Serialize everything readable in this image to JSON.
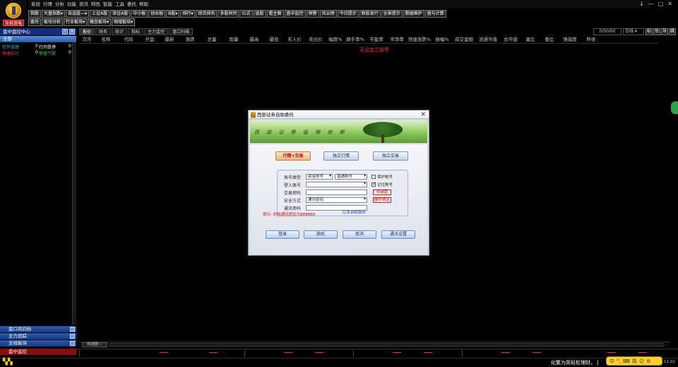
{
  "app": {
    "logo_label": "东财双电"
  },
  "menu": [
    "系统",
    "行情",
    "分析",
    "功能",
    "资讯",
    "特色",
    "智能",
    "工具",
    "委托",
    "帮助"
  ],
  "window_controls": [
    "↓",
    "—",
    "□",
    "✕"
  ],
  "toolbar1": [
    "指数",
    "大盘指数▾",
    "自选股—▾",
    "上证A股",
    "深证A股",
    "中小板",
    "创业板",
    "B股▾",
    "排行▾",
    "综合排名",
    "多股同列",
    "公式",
    "选股",
    "看主图",
    "盘中监控",
    "预警",
    "风云榜",
    "今日提示",
    "新股发行",
    "全景提示",
    "数据维护",
    "盘与计算"
  ],
  "toolbar2": [
    "委托",
    "板块分析",
    "行业板块▾",
    "概念板块▾",
    "地域板块▾"
  ],
  "left_panel": {
    "title": "盘中盘控中心",
    "section": "全部",
    "rows": [
      {
        "label": "打开涨停",
        "value": "0",
        "label2": "打开跌停",
        "value2": "0"
      },
      {
        "label": "快速拉升",
        "value": "0",
        "label2": "快速下跌",
        "value2": "0"
      }
    ],
    "footers": [
      "盘口风向标",
      "主力追踪",
      "主线板块"
    ],
    "bottom_label": "盘中监控"
  },
  "main_tabs": [
    "报价",
    "财务",
    "统计",
    "指标",
    "主力监控",
    "盘口扫描"
  ],
  "date_box": "0/00/00",
  "date_select": "日线 ▾",
  "right_buttons": [
    "标",
    "估",
    "导",
    "跳"
  ],
  "table": {
    "columns": [
      {
        "label": "次序",
        "w": 22
      },
      {
        "label": "名称",
        "w": 32
      },
      {
        "label": "代码",
        "w": 32
      },
      {
        "label": "开盘",
        "w": 28
      },
      {
        "label": "最新",
        "w": 28
      },
      {
        "label": "涨跌",
        "w": 30
      },
      {
        "label": "总量",
        "w": 32
      },
      {
        "label": "现量",
        "w": 30
      },
      {
        "label": "最高",
        "w": 28
      },
      {
        "label": "最低",
        "w": 28
      },
      {
        "label": "买入价",
        "w": 30
      },
      {
        "label": "卖出价",
        "w": 30
      },
      {
        "label": "幅度%",
        "w": 26
      },
      {
        "label": "换手率%",
        "w": 30
      },
      {
        "label": "市盈率",
        "w": 30
      },
      {
        "label": "市净率",
        "w": 28
      },
      {
        "label": "快速涨跌%",
        "w": 36
      },
      {
        "label": "振幅%",
        "w": 28
      },
      {
        "label": "成交金额",
        "w": 34
      },
      {
        "label": "流通市值",
        "w": 34
      },
      {
        "label": "总市值",
        "w": 30
      },
      {
        "label": "量比",
        "w": 26
      },
      {
        "label": "委比",
        "w": 28
      },
      {
        "label": "强弱度",
        "w": 30
      },
      {
        "label": "昨收",
        "w": 30
      }
    ],
    "empty_message": "无设定之股票"
  },
  "sheet_tab": "自选股—",
  "ticker_text": "化繁为简轻松理财。 [",
  "ime": {
    "items": [
      "中",
      "°,",
      "⌨",
      "简",
      "☺",
      "⚙"
    ]
  },
  "clock": "11:01",
  "dialog": {
    "title": "西部证券自助委托",
    "slogan": "西 部 证 券   值 得 信 赖",
    "modes": [
      "行情+交易",
      "独立行情",
      "独立交易"
    ],
    "fields": {
      "account_type_label": "账号类型",
      "account_type_value": "资金账号",
      "account_kind_value": "普通账号",
      "login_account_label": "登入账号",
      "trade_password_label": "交易密码",
      "security_label": "安全方式",
      "security_value": "通讯密码",
      "comm_password_label": "通讯密码"
    },
    "checkboxes": {
      "protect_account": "保护账号",
      "remember_account": "记住账号"
    },
    "mini_buttons": {
      "keyboard": "软键盘",
      "hardware_bind": "硬件绑定"
    },
    "tip": "提示: 初始通讯密码为888888",
    "emergency_link": "应急自助服务",
    "actions": [
      "登录",
      "脱机",
      "取消",
      "通讯设置"
    ]
  }
}
